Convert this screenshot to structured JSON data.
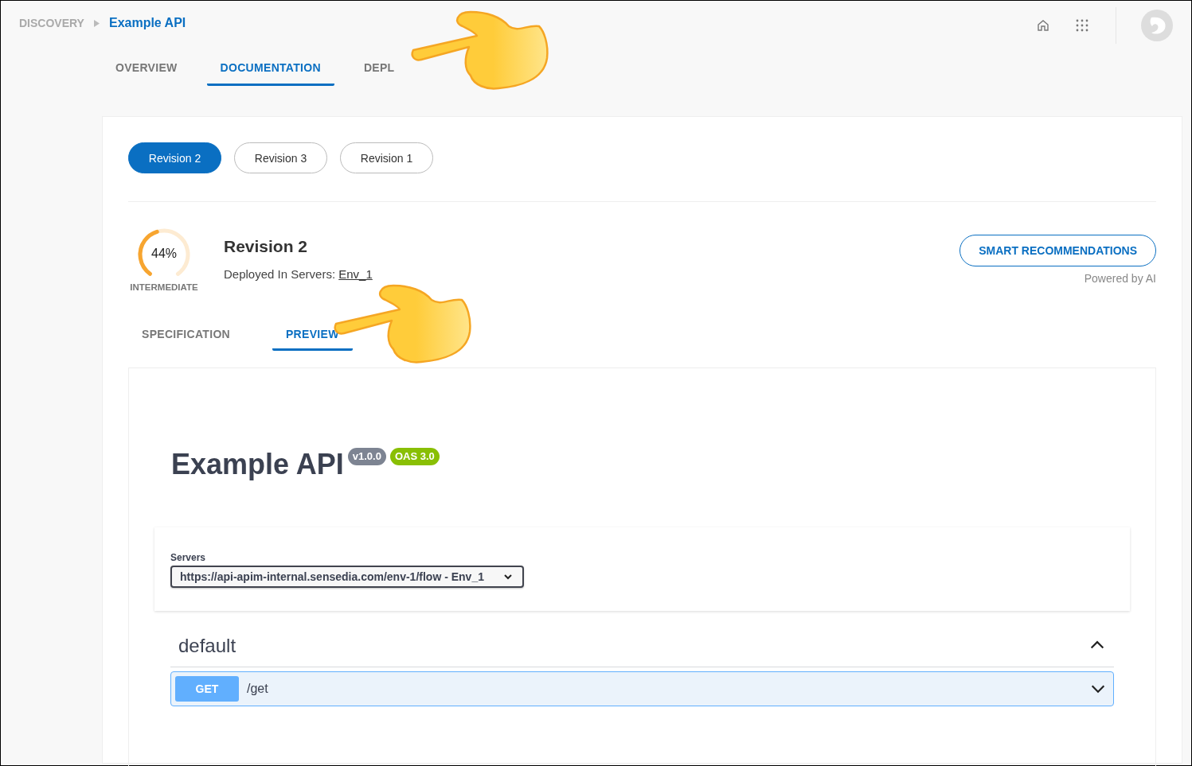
{
  "breadcrumb": [
    {
      "label": "DISCOVERY",
      "selected": false
    },
    {
      "label": "Example API",
      "selected": true
    }
  ],
  "tabs": [
    {
      "label": "OVERVIEW",
      "selected": false
    },
    {
      "label": "DOCUMENTATION",
      "selected": true
    },
    {
      "label": "DEPL",
      "selected": false
    }
  ],
  "revisions": [
    {
      "label": "Revision 2",
      "selected": true
    },
    {
      "label": "Revision 3",
      "selected": false
    },
    {
      "label": "Revision 1",
      "selected": false
    }
  ],
  "score": {
    "level": 0.44,
    "reading": "44%",
    "rating": "INTERMEDIATE"
  },
  "revision": {
    "title": "Revision 2",
    "deployed_label": "Deployed In Servers:",
    "server_link": "Env_1"
  },
  "smart_button": "SMART RECOMMENDATIONS",
  "powered_by": "Powered by AI",
  "subtabs": [
    {
      "label": "SPECIFICATION",
      "selected": false
    },
    {
      "label": "PREVIEW",
      "selected": true
    }
  ],
  "preview": {
    "title": "Example API",
    "badges": [
      {
        "label": "v1.0.0",
        "color": "#7d8492"
      },
      {
        "label": "OAS 3.0",
        "color": "#89bf04"
      }
    ],
    "servers_label": "Servers",
    "server_value": "https://api-apim-internal.sensedia.com/env-1/flow - Env_1",
    "sections": [
      {
        "name": "default",
        "expanded": true,
        "operations": [
          {
            "method": "GET",
            "path": "/get",
            "expanded": false
          }
        ]
      }
    ]
  }
}
